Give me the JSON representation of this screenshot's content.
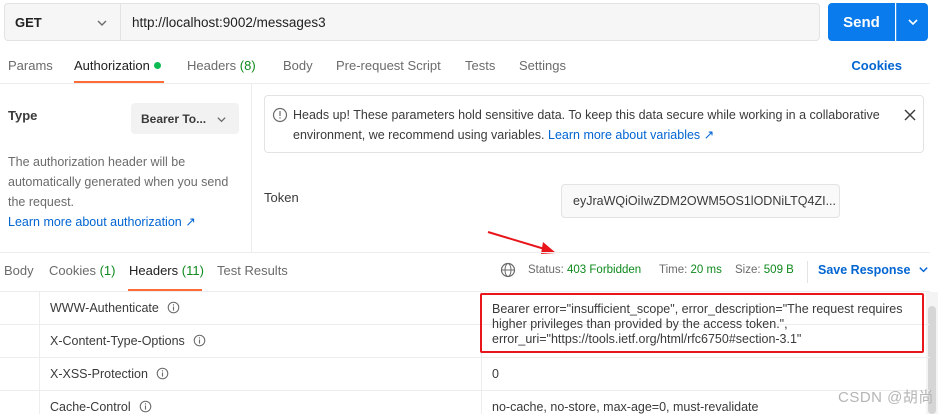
{
  "request": {
    "method": "GET",
    "url": "http://localhost:9002/messages3",
    "send_label": "Send"
  },
  "request_tabs": {
    "params": "Params",
    "authorization": "Authorization",
    "headers": "Headers",
    "headers_count": "(8)",
    "body": "Body",
    "pre_request": "Pre-request Script",
    "tests": "Tests",
    "settings": "Settings",
    "cookies": "Cookies"
  },
  "auth": {
    "type_label": "Type",
    "type_value": "Bearer To...",
    "desc_1": "The authorization header will be automatically generated when you send the request.",
    "learn_more": "Learn more about authorization ↗",
    "alert_text": "Heads up! These parameters hold sensitive data. To keep this data secure while working in a collaborative environment, we recommend using variables.",
    "alert_link": "Learn more about variables ↗",
    "token_label": "Token",
    "token_value": "eyJraWQiOiIwZDM2OWM5OS1lODNiLTQ4ZI..."
  },
  "response_tabs": {
    "body": "Body",
    "cookies": "Cookies",
    "cookies_count": "(1)",
    "headers": "Headers",
    "headers_count": "(11)",
    "test_results": "Test Results",
    "status_label": "Status:",
    "status_value": "403 Forbidden",
    "time_label": "Time:",
    "time_value": "20 ms",
    "size_label": "Size:",
    "size_value": "509 B",
    "save_response": "Save Response"
  },
  "response_headers": [
    {
      "key": "WWW-Authenticate",
      "value": "Bearer error=\"insufficient_scope\", error_description=\"The request requires higher privileges than provided by the access token.\", error_uri=\"https://tools.ietf.org/html/rfc6750#section-3.1\""
    },
    {
      "key": "X-Content-Type-Options",
      "value": ""
    },
    {
      "key": "X-XSS-Protection",
      "value": "0"
    },
    {
      "key": "Cache-Control",
      "value": "no-cache, no-store, max-age=0, must-revalidate"
    }
  ],
  "watermark": "CSDN @胡尚",
  "colors": {
    "accent_blue": "#097bed",
    "tab_underline": "#ff6c37",
    "status_green": "#0f8a1e",
    "link_blue": "#0265d2",
    "highlight_red": "#e8151b"
  }
}
